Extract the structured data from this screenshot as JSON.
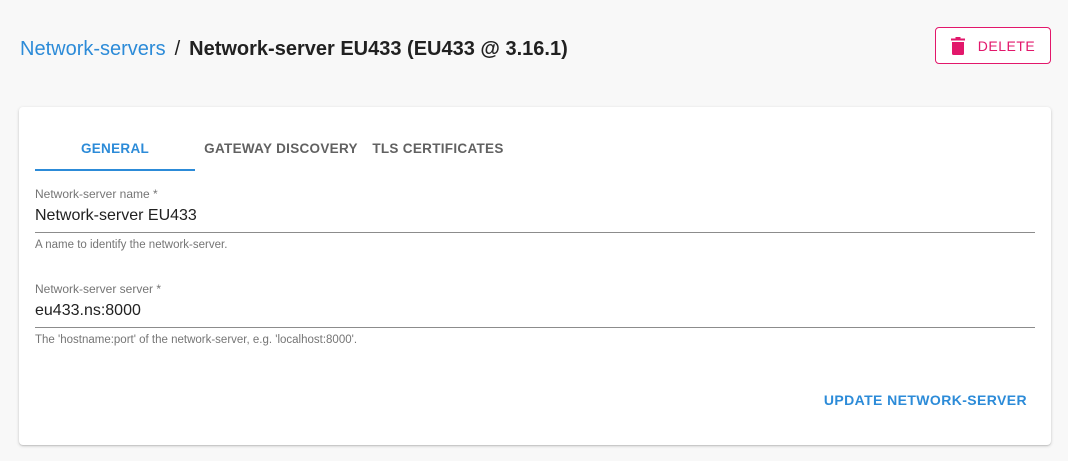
{
  "breadcrumb": {
    "parent_label": "Network-servers",
    "separator": "/",
    "current_label": "Network-server EU433 (EU433 @ 3.16.1)"
  },
  "header": {
    "delete_label": "DELETE",
    "delete_icon": "trash-icon"
  },
  "tabs": [
    {
      "label": "GENERAL",
      "active": true
    },
    {
      "label": "GATEWAY DISCOVERY",
      "active": false
    },
    {
      "label": "TLS CERTIFICATES",
      "active": false
    }
  ],
  "form": {
    "name_field": {
      "label": "Network-server name *",
      "value": "Network-server EU433",
      "help": "A name to identify the network-server."
    },
    "server_field": {
      "label": "Network-server server *",
      "value": "eu433.ns:8000",
      "help": "The 'hostname:port' of the network-server, e.g. 'localhost:8000'."
    },
    "submit_label": "UPDATE NETWORK-SERVER"
  },
  "colors": {
    "primary": "#2c8bd8",
    "danger": "#e2176b",
    "background": "#f8f8f8"
  }
}
